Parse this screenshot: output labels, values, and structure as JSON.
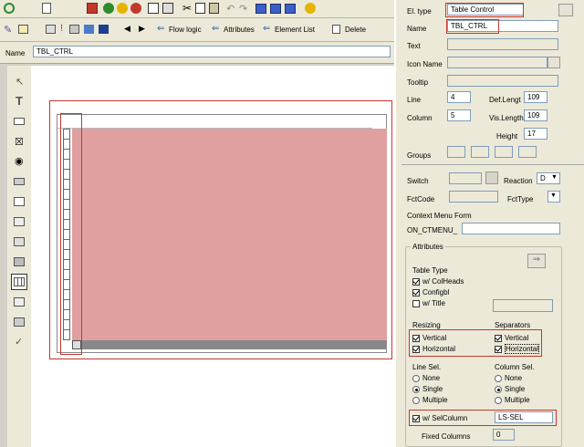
{
  "toolbar2": {
    "flow_logic": "Flow logic",
    "attributes": "Attributes",
    "element_list": "Element List",
    "delete": "Delete"
  },
  "namebar": {
    "label": "Name",
    "value": "TBL_CTRL"
  },
  "panel": {
    "el_type_label": "El. type",
    "el_type_value": "Table Control",
    "name_label": "Name",
    "name_value": "TBL_CTRL",
    "text_label": "Text",
    "icon_name_label": "Icon Name",
    "tooltip_label": "Tooltip",
    "line_label": "Line",
    "line_value": "4",
    "deflength_label": "Def.Lengt",
    "deflength_value": "109",
    "column_label": "Column",
    "column_value": "5",
    "vislength_label": "Vis.Length",
    "vislength_value": "109",
    "height_label": "Height",
    "height_value": "17",
    "groups_label": "Groups",
    "switch_label": "Switch",
    "reaction_label": "Reaction",
    "reaction_value": "D",
    "fctcode_label": "FctCode",
    "fcttype_label": "FctType",
    "context_menu_label": "Context Menu Form",
    "context_menu_prefix": "ON_CTMENU_",
    "attributes_title": "Attributes",
    "table_type_label": "Table Type",
    "colheads_label": "w/ ColHeads",
    "configbl_label": "Configbl",
    "title_label": "w/ Title",
    "resizing_label": "Resizing",
    "resize_vertical": "Vertical",
    "resize_horizontal": "Horizontal",
    "separators_label": "Separators",
    "sep_vertical": "Vertical",
    "sep_horizontal": "Horizontal",
    "line_sel_label": "Line Sel.",
    "col_sel_label": "Column Sel.",
    "none": "None",
    "single": "Single",
    "multiple": "Multiple",
    "selcolumn_label": "w/ SelColumn",
    "selcolumn_value": "LS-SEL",
    "fixed_columns_label": "Fixed Columns",
    "fixed_columns_value": "0"
  },
  "colors": {
    "highlight": "#c7352f",
    "table_fill": "#e0a0a0"
  }
}
